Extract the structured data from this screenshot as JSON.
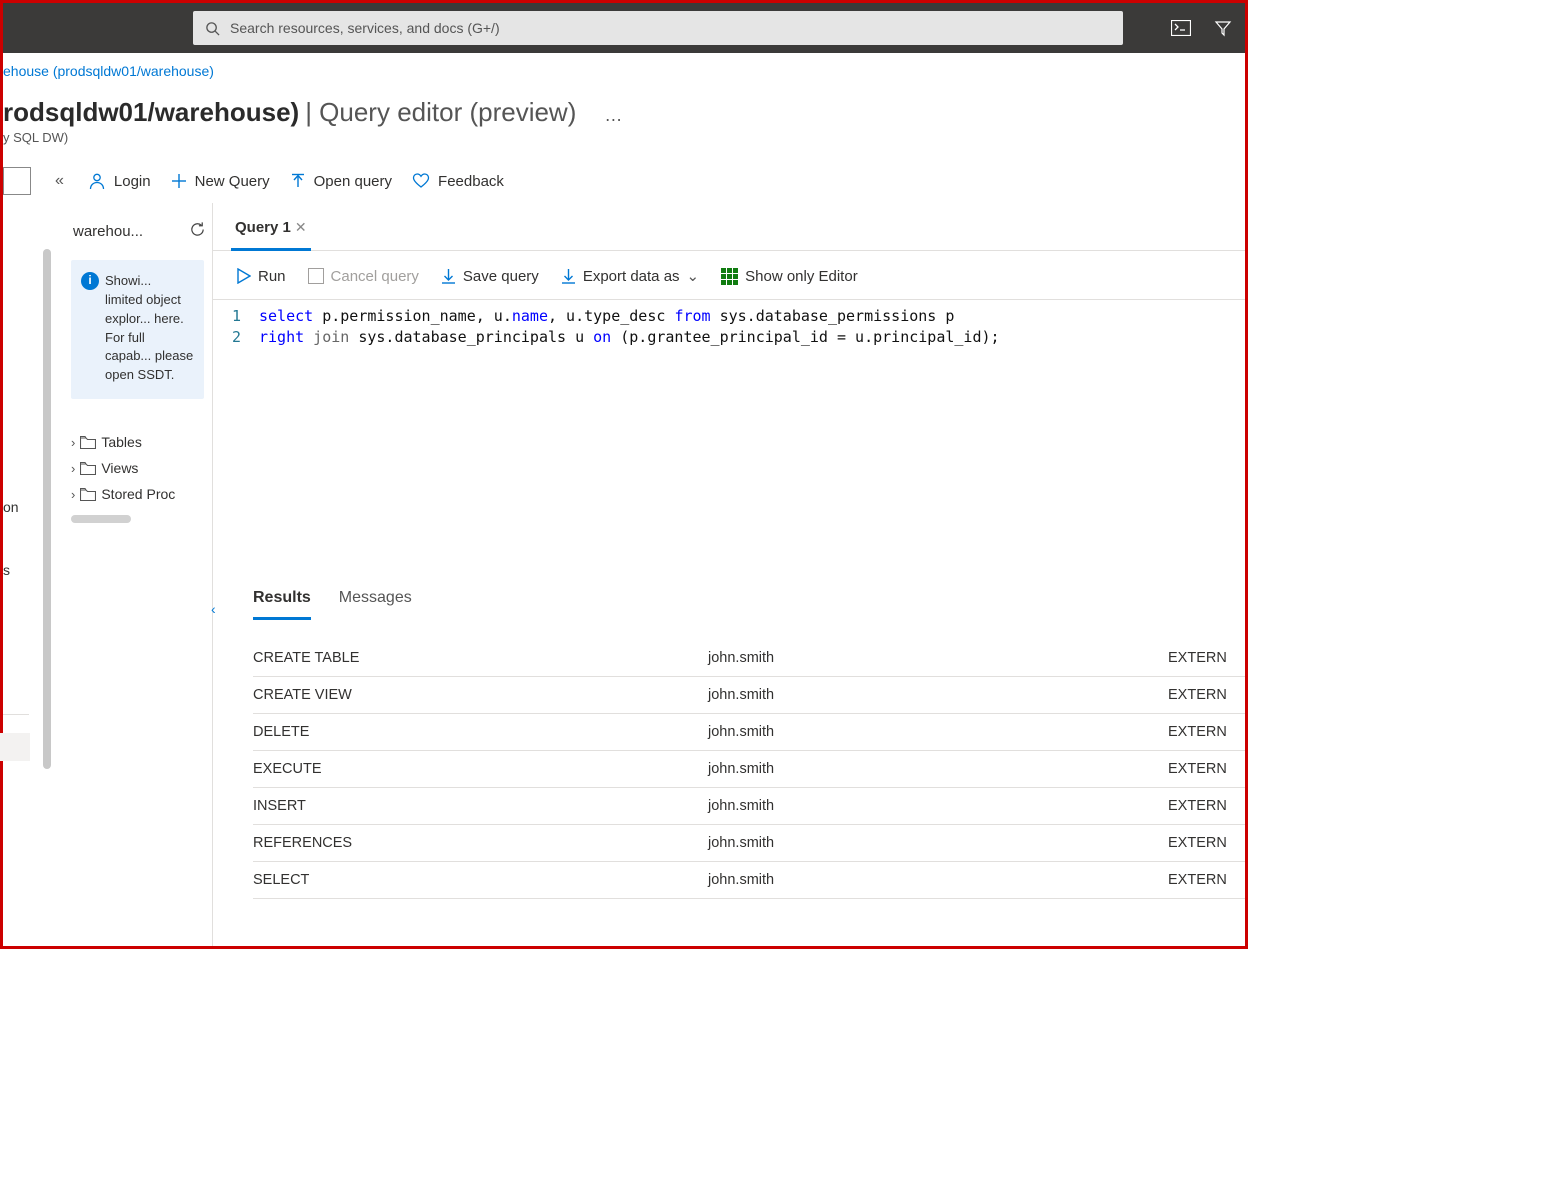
{
  "header": {
    "search_placeholder": "Search resources, services, and docs (G+/)"
  },
  "breadcrumb": {
    "link_text": "ehouse (prodsqldw01/warehouse)"
  },
  "title": {
    "main": "rodsqldw01/warehouse)",
    "sub": "| Query editor (preview)",
    "dots": "…",
    "subtitle": "y SQL DW)"
  },
  "toolbar": {
    "login": "Login",
    "new_query": "New Query",
    "open_query": "Open query",
    "feedback": "Feedback"
  },
  "left_nav": {
    "item_on": "on",
    "item_s": "s"
  },
  "explorer": {
    "title": "warehou...",
    "info_title": "Showi...",
    "info_body": "limited object explor... here. For full capab... please open SSDT.",
    "tables": "Tables",
    "views": "Views",
    "sprocs": "Stored Proc"
  },
  "editor": {
    "tab_label": "Query 1",
    "run": "Run",
    "cancel": "Cancel query",
    "save": "Save query",
    "export": "Export data as",
    "show_only": "Show only Editor",
    "line1_num": "1",
    "line2_num": "2"
  },
  "sql": {
    "l1_select": "select",
    "l1_a": " p.permission_name, u.",
    "l1_name": "name",
    "l1_b": ", u.type_desc ",
    "l1_from": "from",
    "l1_c": " sys.database_permissions p",
    "l2_right": "right",
    "l2_join": " join",
    "l2_a": " sys.database_principals u ",
    "l2_on": "on",
    "l2_b": " (p.grantee_principal_id = u.principal_id);"
  },
  "results": {
    "tab_results": "Results",
    "tab_messages": "Messages",
    "rows": [
      {
        "c1": "CREATE TABLE",
        "c2": "john.smith",
        "c3": "EXTERN"
      },
      {
        "c1": "CREATE VIEW",
        "c2": "john.smith",
        "c3": "EXTERN"
      },
      {
        "c1": "DELETE",
        "c2": "john.smith",
        "c3": "EXTERN"
      },
      {
        "c1": "EXECUTE",
        "c2": "john.smith",
        "c3": "EXTERN"
      },
      {
        "c1": "INSERT",
        "c2": "john.smith",
        "c3": "EXTERN"
      },
      {
        "c1": "REFERENCES",
        "c2": "john.smith",
        "c3": "EXTERN"
      },
      {
        "c1": "SELECT",
        "c2": "john.smith",
        "c3": "EXTERN"
      }
    ]
  }
}
